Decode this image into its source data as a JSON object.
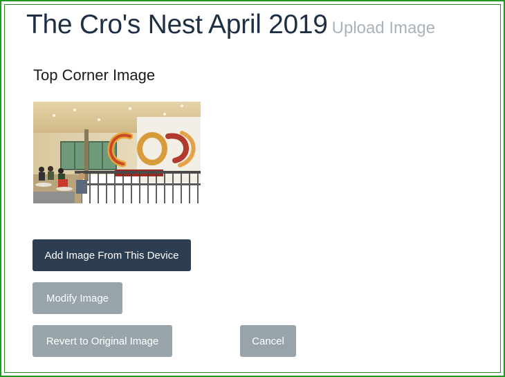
{
  "header": {
    "title": "The Cro's Nest April 2019",
    "subtitle": "Upload Image"
  },
  "section": {
    "label": "Top Corner Image"
  },
  "image": {
    "caption_logo": "Co"
  },
  "buttons": {
    "add_image": "Add Image From This Device",
    "modify": "Modify Image",
    "revert": "Revert to Original Image",
    "cancel": "Cancel"
  },
  "colors": {
    "primary_button": "#2d3e53",
    "secondary_button": "#98a4aa",
    "title": "#1f3044",
    "subtitle": "#a9b3ba",
    "frame": "#1f9a1f"
  }
}
